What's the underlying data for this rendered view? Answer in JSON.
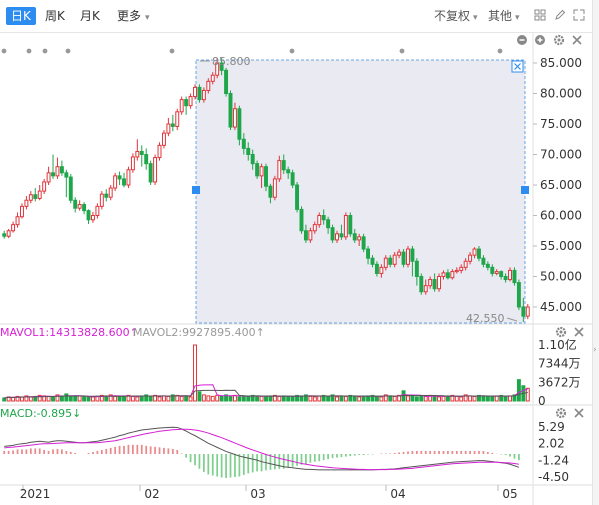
{
  "tabs": [
    {
      "label": "日K",
      "active": true
    },
    {
      "label": "周K"
    },
    {
      "label": "月K"
    },
    {
      "label": "更多",
      "dropdown": true
    }
  ],
  "right_menu": {
    "adjust": "不复权",
    "other": "其他"
  },
  "icons": [
    "grid-icon",
    "edit-icon",
    "expand-icon"
  ],
  "price_axis": {
    "labels": [
      "85.000",
      "80.000",
      "75.000",
      "70.000",
      "65.000",
      "60.000",
      "55.000",
      "50.000",
      "45.000"
    ],
    "high_label": "85.800",
    "low_label": "42.550"
  },
  "volume": {
    "mavol1": "MAVOL1:14313828.600↑",
    "mavol2": "MAVOL2:9927895.400↑",
    "axis": [
      "1.10亿",
      "7344万",
      "3672万",
      "0"
    ]
  },
  "macd": {
    "label": "MACD:-0.895↓",
    "axis": [
      "5.29",
      "2.02",
      "-1.24",
      "-4.50"
    ]
  },
  "time_axis": [
    "2021",
    "02",
    "03",
    "04",
    "05"
  ],
  "colors": {
    "up": "#e0353b",
    "down": "#1fa64a",
    "selection": "#2d8cf0",
    "active_tab": "#2d8cf0",
    "ma1": "#d61fd6",
    "ma2": "#555555"
  },
  "chart_data": {
    "type": "candlestick",
    "price_range": [
      42,
      88
    ],
    "candles": [
      [
        57.0,
        56.6,
        57.5,
        56.2
      ],
      [
        56.6,
        57.5,
        57.8,
        56.3
      ],
      [
        57.5,
        58.5,
        59.0,
        57.2
      ],
      [
        58.5,
        59.8,
        60.5,
        58.0
      ],
      [
        59.8,
        61.5,
        62.0,
        59.5
      ],
      [
        61.5,
        62.5,
        63.2,
        61.0
      ],
      [
        62.5,
        63.4,
        64.0,
        62.0
      ],
      [
        63.4,
        62.8,
        64.5,
        62.3
      ],
      [
        62.8,
        64.0,
        65.0,
        62.5
      ],
      [
        64.0,
        65.5,
        66.0,
        63.5
      ],
      [
        65.5,
        67.0,
        68.0,
        65.0
      ],
      [
        67.0,
        66.5,
        70.0,
        66.0
      ],
      [
        66.5,
        68.0,
        69.5,
        66.0
      ],
      [
        68.0,
        67.0,
        69.0,
        66.5
      ],
      [
        67.0,
        66.3,
        67.5,
        63.0
      ],
      [
        66.3,
        62.5,
        66.8,
        62.0
      ],
      [
        62.5,
        61.2,
        63.0,
        60.5
      ],
      [
        61.2,
        61.8,
        62.5,
        60.8
      ],
      [
        61.8,
        60.8,
        62.2,
        60.2
      ],
      [
        60.8,
        59.3,
        61.0,
        58.6
      ],
      [
        59.3,
        60.0,
        60.6,
        58.8
      ],
      [
        60.0,
        61.5,
        62.0,
        59.5
      ],
      [
        61.5,
        63.5,
        64.0,
        61.0
      ],
      [
        63.5,
        63.0,
        64.3,
        62.3
      ],
      [
        63.0,
        64.5,
        65.0,
        62.5
      ],
      [
        64.5,
        66.5,
        67.0,
        64.0
      ],
      [
        66.5,
        66.0,
        67.2,
        65.0
      ],
      [
        66.0,
        65.0,
        67.0,
        64.6
      ],
      [
        65.0,
        67.5,
        68.0,
        64.5
      ],
      [
        67.5,
        69.6,
        70.2,
        67.0
      ],
      [
        69.6,
        70.5,
        72.5,
        69.0
      ],
      [
        70.5,
        70.0,
        71.5,
        68.0
      ],
      [
        70.0,
        68.5,
        71.0,
        67.5
      ],
      [
        68.5,
        65.5,
        69.0,
        65.0
      ],
      [
        65.5,
        69.5,
        70.0,
        65.0
      ],
      [
        69.5,
        71.5,
        72.0,
        69.0
      ],
      [
        71.5,
        73.5,
        74.0,
        71.0
      ],
      [
        73.5,
        75.0,
        76.0,
        73.0
      ],
      [
        75.0,
        74.6,
        76.5,
        73.8
      ],
      [
        74.6,
        77.0,
        77.5,
        74.0
      ],
      [
        77.0,
        79.0,
        79.5,
        76.5
      ],
      [
        79.0,
        78.0,
        79.5,
        76.5
      ],
      [
        78.0,
        79.5,
        80.0,
        77.5
      ],
      [
        79.5,
        81.0,
        81.5,
        79.0
      ],
      [
        81.0,
        79.0,
        81.5,
        78.5
      ],
      [
        79.0,
        80.5,
        81.0,
        78.5
      ],
      [
        80.5,
        82.0,
        82.5,
        80.0
      ],
      [
        82.0,
        83.0,
        83.5,
        81.5
      ],
      [
        83.0,
        85.0,
        85.8,
        82.5
      ],
      [
        85.0,
        83.8,
        85.8,
        83.0
      ],
      [
        83.8,
        80.0,
        84.2,
        79.5
      ],
      [
        80.0,
        74.5,
        80.5,
        74.0
      ],
      [
        74.5,
        77.5,
        78.5,
        74.0
      ],
      [
        77.5,
        72.5,
        78.0,
        71.5
      ],
      [
        72.5,
        71.0,
        73.5,
        70.0
      ],
      [
        71.0,
        70.0,
        72.0,
        69.0
      ],
      [
        70.0,
        68.5,
        70.8,
        67.5
      ],
      [
        68.5,
        66.5,
        69.0,
        66.0
      ],
      [
        66.5,
        68.0,
        68.5,
        64.5
      ],
      [
        68.0,
        64.8,
        68.5,
        64.0
      ],
      [
        64.8,
        63.0,
        65.2,
        62.0
      ],
      [
        63.0,
        66.0,
        66.5,
        62.5
      ],
      [
        66.0,
        69.0,
        69.8,
        65.5
      ],
      [
        69.0,
        67.5,
        70.0,
        66.8
      ],
      [
        67.5,
        67.0,
        68.0,
        66.0
      ],
      [
        67.0,
        65.0,
        67.5,
        64.5
      ],
      [
        65.0,
        61.0,
        65.5,
        60.5
      ],
      [
        61.0,
        57.5,
        61.5,
        57.0
      ],
      [
        57.5,
        56.0,
        58.5,
        55.5
      ],
      [
        56.0,
        57.5,
        58.0,
        55.5
      ],
      [
        57.5,
        58.5,
        59.0,
        57.0
      ],
      [
        58.5,
        60.0,
        60.5,
        58.0
      ],
      [
        60.0,
        59.3,
        61.0,
        58.5
      ],
      [
        59.3,
        58.0,
        59.8,
        57.0
      ],
      [
        58.0,
        56.0,
        58.5,
        55.5
      ],
      [
        56.0,
        57.0,
        57.5,
        55.5
      ],
      [
        57.0,
        56.5,
        58.5,
        56.0
      ],
      [
        56.5,
        60.0,
        60.5,
        56.0
      ],
      [
        60.0,
        57.0,
        60.5,
        56.5
      ],
      [
        57.0,
        56.0,
        57.8,
        55.5
      ],
      [
        56.0,
        56.5,
        57.0,
        55.0
      ],
      [
        56.5,
        54.5,
        57.0,
        54.0
      ],
      [
        54.5,
        53.0,
        55.0,
        52.0
      ],
      [
        53.0,
        52.0,
        53.5,
        51.5
      ],
      [
        52.0,
        50.5,
        52.5,
        50.0
      ],
      [
        50.5,
        51.5,
        52.0,
        49.8
      ],
      [
        51.5,
        53.0,
        53.5,
        51.0
      ],
      [
        53.0,
        52.0,
        53.5,
        51.5
      ],
      [
        52.0,
        53.5,
        54.0,
        51.5
      ],
      [
        53.5,
        54.0,
        54.5,
        53.0
      ],
      [
        54.0,
        52.0,
        54.5,
        51.5
      ],
      [
        52.0,
        54.5,
        55.0,
        51.5
      ],
      [
        54.5,
        52.5,
        55.0,
        50.0
      ],
      [
        52.5,
        50.0,
        53.0,
        48.5
      ],
      [
        50.0,
        47.5,
        50.5,
        47.0
      ],
      [
        47.5,
        48.5,
        49.5,
        47.0
      ],
      [
        48.5,
        49.5,
        50.0,
        48.0
      ],
      [
        49.5,
        48.0,
        50.5,
        47.5
      ],
      [
        48.0,
        50.0,
        50.5,
        47.5
      ],
      [
        50.0,
        50.6,
        51.0,
        49.5
      ],
      [
        50.6,
        49.8,
        51.2,
        49.5
      ],
      [
        49.8,
        50.8,
        51.2,
        49.5
      ],
      [
        50.8,
        51.0,
        51.5,
        50.5
      ],
      [
        51.0,
        51.5,
        52.0,
        50.5
      ],
      [
        51.5,
        52.5,
        53.0,
        51.0
      ],
      [
        52.5,
        53.5,
        54.0,
        52.0
      ],
      [
        53.5,
        54.5,
        54.8,
        53.0
      ],
      [
        54.5,
        53.0,
        55.0,
        52.5
      ],
      [
        53.0,
        52.0,
        53.5,
        51.5
      ],
      [
        52.0,
        51.5,
        52.5,
        51.0
      ],
      [
        51.5,
        50.5,
        52.0,
        50.0
      ],
      [
        50.5,
        50.8,
        51.2,
        50.2
      ],
      [
        50.8,
        50.0,
        51.0,
        49.5
      ],
      [
        50.0,
        49.5,
        50.5,
        49.0
      ],
      [
        49.5,
        51.0,
        51.5,
        49.2
      ],
      [
        51.0,
        49.0,
        51.5,
        48.5
      ],
      [
        49.0,
        45.0,
        49.5,
        44.5
      ],
      [
        45.0,
        43.5,
        46.5,
        42.55
      ],
      [
        43.5,
        45.0,
        45.5,
        43.0
      ]
    ],
    "volume_range": [
      0,
      110000000
    ],
    "volumes": [
      6,
      8,
      7,
      9,
      8,
      10,
      8,
      9,
      11,
      10,
      9,
      7,
      12,
      10,
      14,
      9,
      8,
      10,
      9,
      7,
      8,
      9,
      11,
      10,
      12,
      9,
      8,
      10,
      11,
      9,
      8,
      10,
      12,
      9,
      11,
      8,
      10,
      9,
      12,
      11,
      9,
      10,
      8,
      110,
      18,
      12,
      10,
      9,
      11,
      10,
      12,
      9,
      11,
      8,
      10,
      9,
      11,
      10,
      9,
      8,
      10,
      11,
      9,
      10,
      8,
      9,
      11,
      10,
      12,
      9,
      8,
      10,
      11,
      9,
      12,
      8,
      10,
      9,
      11,
      10,
      8,
      9,
      10,
      11,
      9,
      8,
      12,
      10,
      9,
      11,
      20,
      10,
      9,
      8,
      10,
      9,
      11,
      10,
      8,
      9,
      10,
      11,
      9,
      8,
      12,
      10,
      9,
      11,
      10,
      9,
      8,
      10,
      11,
      9,
      10,
      12,
      42,
      30,
      25
    ],
    "macd_range": [
      -5.3,
      5.6
    ],
    "dif": [
      1.5,
      1.6,
      1.7,
      1.9,
      2.0,
      2.1,
      2.3,
      2.4,
      2.5,
      2.4,
      2.3,
      2.5,
      2.6,
      2.6,
      2.5,
      2.4,
      2.3,
      2.2,
      2.2,
      2.3,
      2.4,
      2.5,
      2.7,
      2.9,
      3.1,
      3.3,
      3.6,
      3.8,
      4.1,
      4.3,
      4.5,
      4.7,
      4.8,
      4.9,
      5.0,
      5.1,
      5.15,
      5.2,
      5.25,
      5.2,
      4.9,
      4.5,
      4.0,
      3.6,
      3.1,
      2.6,
      2.1,
      1.7,
      1.3,
      0.9,
      0.5,
      0.2,
      -0.1,
      -0.4,
      -0.6,
      -0.8,
      -1.0,
      -1.2,
      -1.5,
      -1.7,
      -1.9,
      -2.1,
      -2.3,
      -2.5,
      -2.6,
      -2.7,
      -2.8,
      -2.9,
      -3.0,
      -3.0,
      -3.05,
      -3.1,
      -3.1,
      -3.1,
      -3.1,
      -3.1,
      -3.1,
      -3.1,
      -3.1,
      -3.1,
      -3.1,
      -3.1,
      -3.1,
      -3.1,
      -3.05,
      -3.0,
      -3.0,
      -2.95,
      -2.9,
      -2.8,
      -2.7,
      -2.6,
      -2.5,
      -2.4,
      -2.3,
      -2.2,
      -2.1,
      -2.0,
      -1.9,
      -1.8,
      -1.7,
      -1.6,
      -1.55,
      -1.5,
      -1.45,
      -1.4,
      -1.35,
      -1.3,
      -1.3,
      -1.4,
      -1.5,
      -1.6,
      -1.7,
      -1.8,
      -2.0,
      -2.3,
      -2.6
    ],
    "dea": [
      1.2,
      1.3,
      1.35,
      1.45,
      1.55,
      1.65,
      1.75,
      1.85,
      1.95,
      2.0,
      2.0,
      2.05,
      2.1,
      2.15,
      2.2,
      2.2,
      2.2,
      2.2,
      2.2,
      2.2,
      2.2,
      2.2,
      2.3,
      2.4,
      2.5,
      2.6,
      2.8,
      3.0,
      3.2,
      3.4,
      3.6,
      3.8,
      4.0,
      4.15,
      4.3,
      4.45,
      4.55,
      4.65,
      4.75,
      4.8,
      4.85,
      4.85,
      4.8,
      4.7,
      4.55,
      4.35,
      4.1,
      3.8,
      3.5,
      3.2,
      2.85,
      2.5,
      2.15,
      1.8,
      1.45,
      1.1,
      0.8,
      0.5,
      0.2,
      -0.1,
      -0.35,
      -0.6,
      -0.85,
      -1.05,
      -1.25,
      -1.45,
      -1.65,
      -1.85,
      -2.0,
      -2.15,
      -2.3,
      -2.4,
      -2.5,
      -2.6,
      -2.7,
      -2.75,
      -2.8,
      -2.85,
      -2.9,
      -2.95,
      -3.0,
      -3.0,
      -3.05,
      -3.05,
      -3.05,
      -3.05,
      -3.05,
      -3.0,
      -3.0,
      -2.95,
      -2.9,
      -2.85,
      -2.8,
      -2.7,
      -2.6,
      -2.5,
      -2.4,
      -2.3,
      -2.2,
      -2.1,
      -2.0,
      -1.9,
      -1.85,
      -1.8,
      -1.75,
      -1.7,
      -1.65,
      -1.6,
      -1.6,
      -1.6,
      -1.6,
      -1.62,
      -1.65,
      -1.7,
      -1.75,
      -1.85,
      -2.0
    ]
  }
}
